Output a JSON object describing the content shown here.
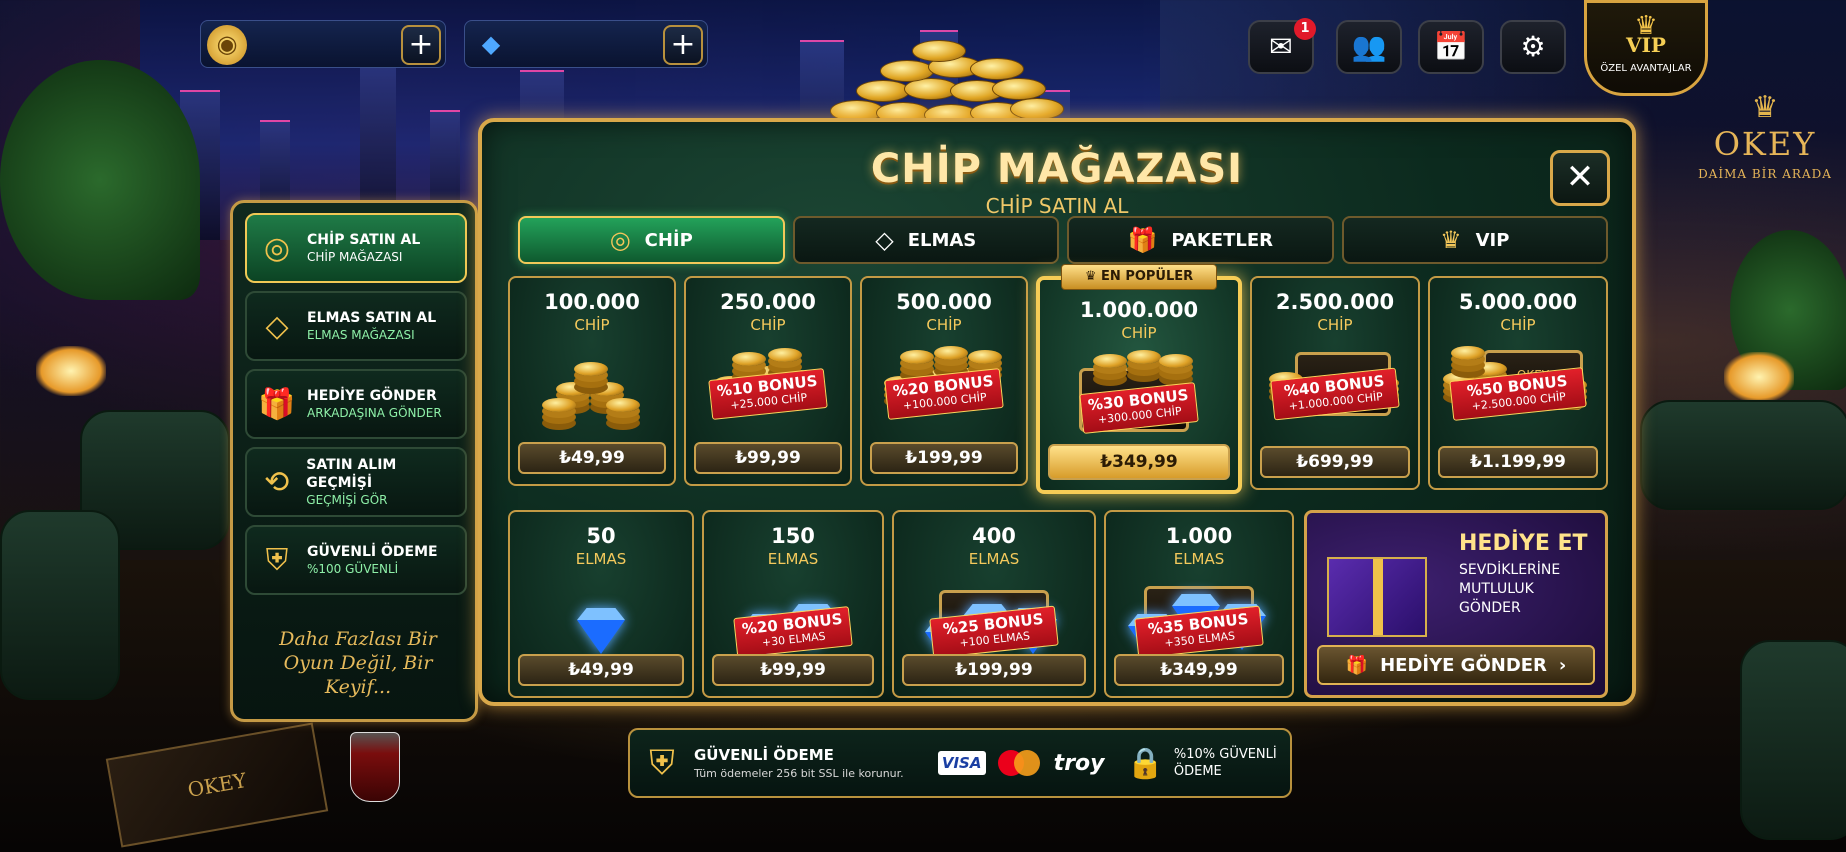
{
  "topbar": {
    "chip_balance": "",
    "diamond_balance": "",
    "mail_badge": "1",
    "vip_label": "VIP",
    "vip_sub": "ÖZEL AVANTAJLAR"
  },
  "brand": {
    "name": "OKEY",
    "tagline": "DAİMA BİR ARADA",
    "box_label": "OKEY"
  },
  "store": {
    "title": "CHİP MAĞAZASI",
    "subtitle": "CHİP SATIN AL",
    "tabs": [
      {
        "label": "CHİP",
        "icon": "coins-icon",
        "active": true
      },
      {
        "label": "ELMAS",
        "icon": "diamond-icon",
        "active": false
      },
      {
        "label": "PAKETLER",
        "icon": "gift-icon",
        "active": false
      },
      {
        "label": "VIP",
        "icon": "crown-icon",
        "active": false
      }
    ],
    "chip_packs": [
      {
        "amount": "100.000",
        "unit": "CHİP",
        "price": "₺49,99"
      },
      {
        "amount": "250.000",
        "unit": "CHİP",
        "bonus": "%10 BONUS",
        "bonus_extra": "+25.000 CHİP",
        "price": "₺99,99"
      },
      {
        "amount": "500.000",
        "unit": "CHİP",
        "bonus": "%20 BONUS",
        "bonus_extra": "+100.000 CHİP",
        "price": "₺199,99"
      },
      {
        "amount": "1.000.000",
        "unit": "CHİP",
        "badge": "EN POPÜLER",
        "bonus": "%30 BONUS",
        "bonus_extra": "+300.000 CHİP",
        "price": "₺349,99"
      },
      {
        "amount": "2.500.000",
        "unit": "CHİP",
        "bonus": "%40 BONUS",
        "bonus_extra": "+1.000.000 CHİP",
        "price": "₺699,99"
      },
      {
        "amount": "5.000.000",
        "unit": "CHİP",
        "chest_label": "OKEY",
        "bonus": "%50 BONUS",
        "bonus_extra": "+2.500.000 CHİP",
        "price": "₺1.199,99"
      }
    ],
    "diamond_packs": [
      {
        "amount": "50",
        "unit": "ELMAS",
        "price": "₺49,99"
      },
      {
        "amount": "150",
        "unit": "ELMAS",
        "bonus": "%20 BONUS",
        "bonus_extra": "+30 ELMAS",
        "price": "₺99,99"
      },
      {
        "amount": "400",
        "unit": "ELMAS",
        "bonus": "%25 BONUS",
        "bonus_extra": "+100 ELMAS",
        "price": "₺199,99"
      },
      {
        "amount": "1.000",
        "unit": "ELMAS",
        "bonus": "%35 BONUS",
        "bonus_extra": "+350 ELMAS",
        "price": "₺349,99"
      }
    ],
    "gift": {
      "title": "HEDİYE ET",
      "desc": "SEVDİKLERİNE MUTLULUK GÖNDER",
      "button": "HEDİYE GÖNDER"
    }
  },
  "sidebar": {
    "items": [
      {
        "title": "CHİP SATIN AL",
        "sub": "CHİP MAĞAZASI",
        "icon": "coins-icon",
        "active": true
      },
      {
        "title": "ELMAS SATIN AL",
        "sub": "ELMAS MAĞAZASI",
        "icon": "diamond-icon"
      },
      {
        "title": "HEDİYE GÖNDER",
        "sub": "ARKADAŞINA GÖNDER",
        "icon": "gift-icon"
      },
      {
        "title": "SATIN ALIM GEÇMİŞİ",
        "sub": "GEÇMİŞİ GÖR",
        "icon": "history-icon"
      },
      {
        "title": "GÜVENLİ ÖDEME",
        "sub": "%100 GÜVENLİ",
        "icon": "shield-icon"
      }
    ],
    "slogan": "Daha Fazlası Bir Oyun Değil, Bir Keyif..."
  },
  "footer": {
    "title": "GÜVENLİ ÖDEME",
    "desc": "Tüm ödemeler 256 bit SSL ile korunur.",
    "visa": "VISA",
    "troy": "troy",
    "secure_text": "%10% GÜVENLİ ÖDEME"
  },
  "colors": {
    "gold": "#d9a84a",
    "panel_green": "#0c2a1e",
    "active_green": "#1f7b47",
    "bonus_red": "#e2202a"
  }
}
